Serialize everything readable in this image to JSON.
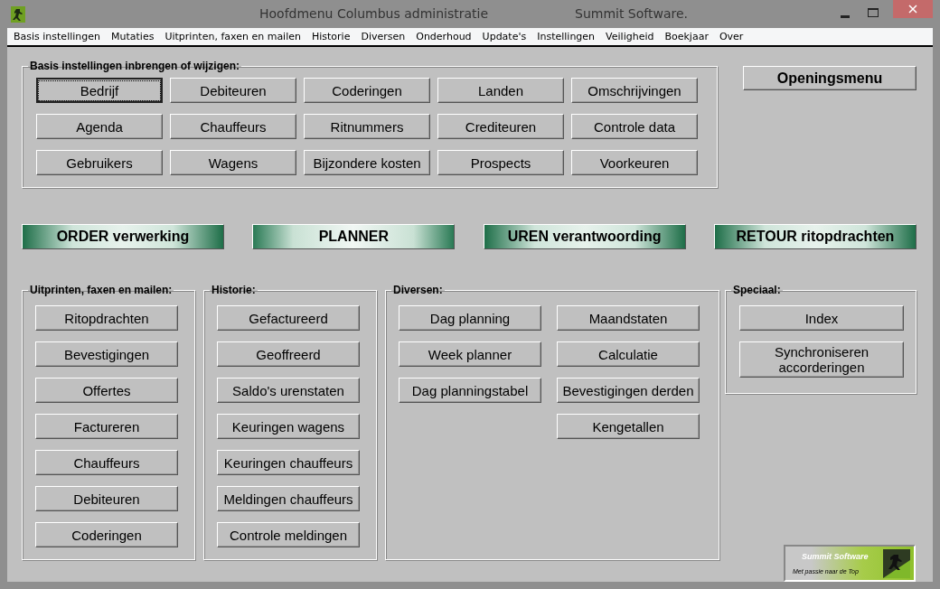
{
  "window": {
    "title": "Hoofdmenu Columbus administratie",
    "subtitle": "Summit Software."
  },
  "menu": [
    "Basis instellingen",
    "Mutaties",
    "Uitprinten, faxen en mailen",
    "Historie",
    "Diversen",
    "Onderhoud",
    "Update's",
    "Instellingen",
    "Veiligheid",
    "Boekjaar",
    "Over"
  ],
  "basis": {
    "title": "Basis instellingen inbrengen of wijzigen:",
    "buttons": [
      {
        "label": "Bedrijf",
        "focused": true
      },
      {
        "label": "Debiteuren",
        "focused": false
      },
      {
        "label": "Coderingen",
        "focused": false
      },
      {
        "label": "Landen",
        "focused": false
      },
      {
        "label": "Omschrijvingen",
        "focused": false
      },
      {
        "label": "Agenda",
        "focused": false
      },
      {
        "label": "Chauffeurs",
        "focused": false
      },
      {
        "label": "Ritnummers",
        "focused": false
      },
      {
        "label": "Crediteuren",
        "focused": false
      },
      {
        "label": "Controle data",
        "focused": false
      },
      {
        "label": "Gebruikers",
        "focused": false
      },
      {
        "label": "Wagens",
        "focused": false
      },
      {
        "label": "Bijzondere kosten",
        "focused": false
      },
      {
        "label": "Prospects",
        "focused": false
      },
      {
        "label": "Voorkeuren",
        "focused": false
      }
    ]
  },
  "openingsmenu": "Openingsmenu",
  "main_buttons": [
    {
      "label": "ORDER verwerking",
      "highlighted": false
    },
    {
      "label": "PLANNER",
      "highlighted": true
    },
    {
      "label": "UREN verantwoording",
      "highlighted": false
    },
    {
      "label": "RETOUR ritopdrachten",
      "highlighted": false
    }
  ],
  "groups": [
    {
      "title": "Uitprinten, faxen en mailen:",
      "columns": [
        [
          "Ritopdrachten",
          "Bevestigingen",
          "Offertes",
          "Factureren",
          "Chauffeurs",
          "Debiteuren",
          "Coderingen"
        ]
      ]
    },
    {
      "title": "Historie:",
      "columns": [
        [
          "Gefactureerd",
          "Geoffreerd",
          "Saldo's urenstaten",
          "Keuringen wagens",
          "Keuringen chauffeurs",
          "Meldingen chauffeurs",
          "Controle meldingen"
        ]
      ]
    },
    {
      "title": "Diversen:",
      "columns": [
        [
          "Dag planning",
          "Week planner",
          "Dag planningstabel"
        ],
        [
          "Maandstaten",
          "Calculatie",
          "Bevestigingen derden",
          "Kengetallen"
        ]
      ]
    },
    {
      "title": "Speciaal:",
      "columns": [
        [
          "Index",
          "Synchroniseren accorderingen"
        ]
      ]
    }
  ],
  "logo": {
    "title": "Summit Software",
    "tagline": "Met passie naar de Top"
  }
}
